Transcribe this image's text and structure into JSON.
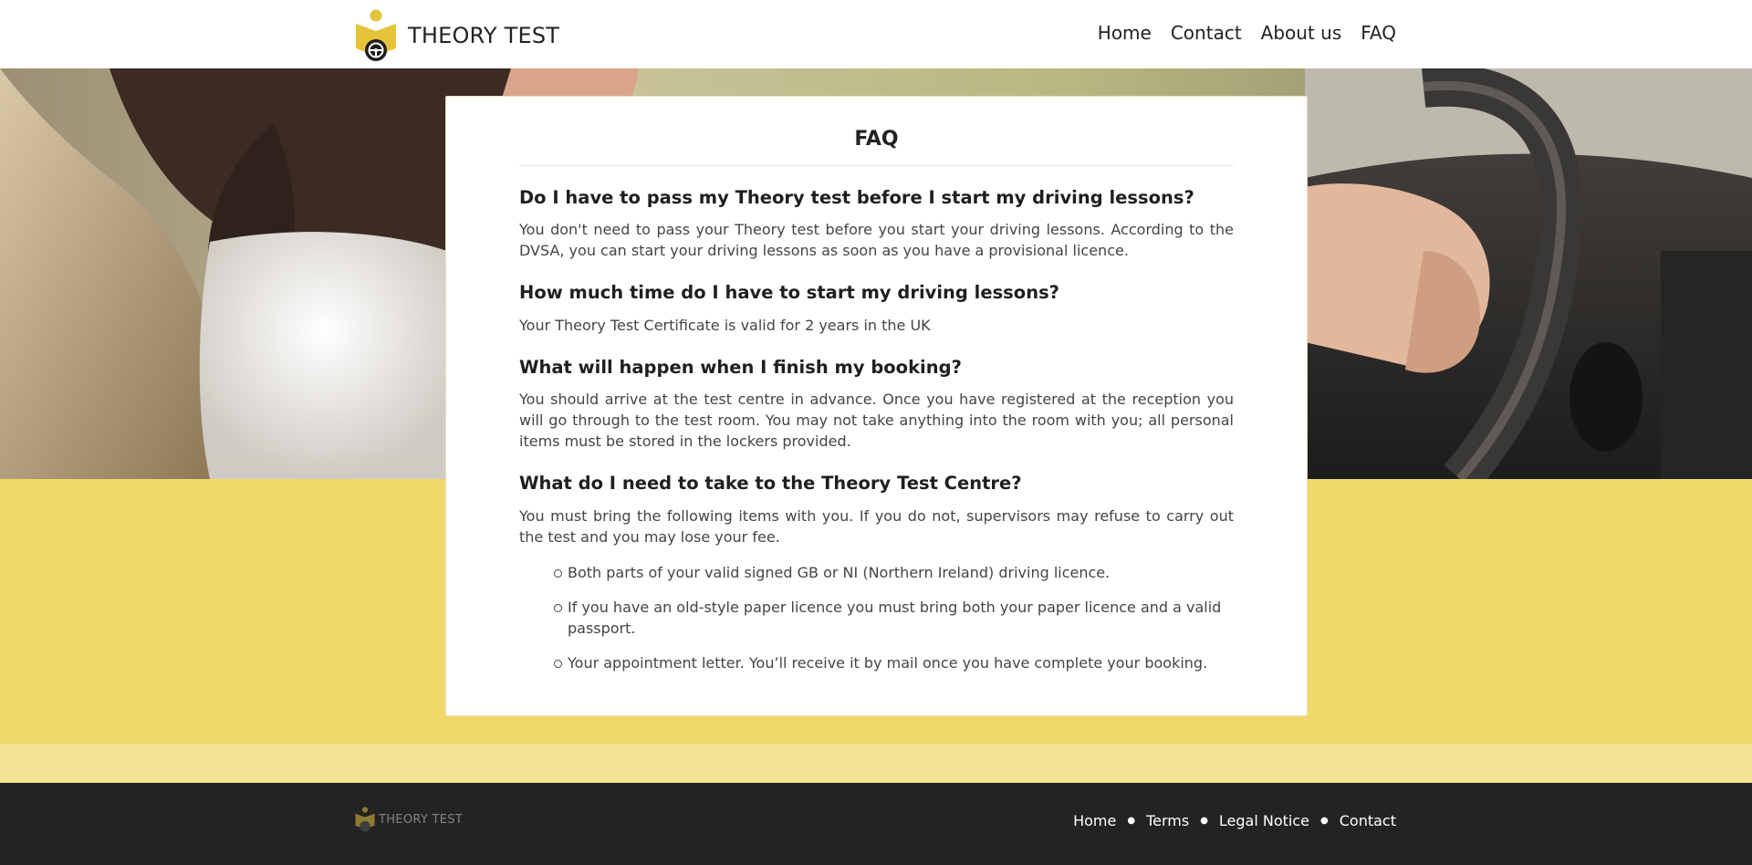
{
  "header": {
    "brand": "THEORY TEST",
    "nav": [
      "Home",
      "Contact",
      "About us",
      "FAQ"
    ]
  },
  "faq": {
    "title": "FAQ",
    "items": [
      {
        "question": "Do I have to pass my Theory test before I start my driving lessons?",
        "answer": "You don't need to pass your Theory test before you start your driving lessons. According to the DVSA, you can start your driving lessons as soon as you have a provisional licence."
      },
      {
        "question": "How much time do I have to start my driving lessons?",
        "answer": "Your Theory Test Certificate is valid for 2 years in the UK"
      },
      {
        "question": "What will happen when I finish my booking?",
        "answer": "You should arrive at the test centre in advance. Once you have registered at the reception you will go through to the test room. You may not take anything into the room with you; all personal items must be stored in the lockers provided."
      },
      {
        "question": "What do I need to take to the Theory Test Centre?",
        "answer": "You must bring the following items with you. If you do not, supervisors may refuse to carry out the test and you may lose your fee."
      }
    ],
    "list": [
      "Both parts of your valid signed GB or NI (Northern Ireland) driving licence.",
      "If you have an old-style paper licence you must bring both your paper licence and a valid passport.",
      "Your appointment letter. You’ll receive it by mail once you have complete your booking."
    ]
  },
  "footer": {
    "brand": "THEORY TEST",
    "links": [
      "Home",
      "Terms",
      "Legal Notice",
      "Contact"
    ],
    "separator": "●"
  },
  "colors": {
    "accent_yellow": "#f0d86b",
    "footer_bg": "#232323",
    "logo_yellow": "#e6c43a"
  }
}
